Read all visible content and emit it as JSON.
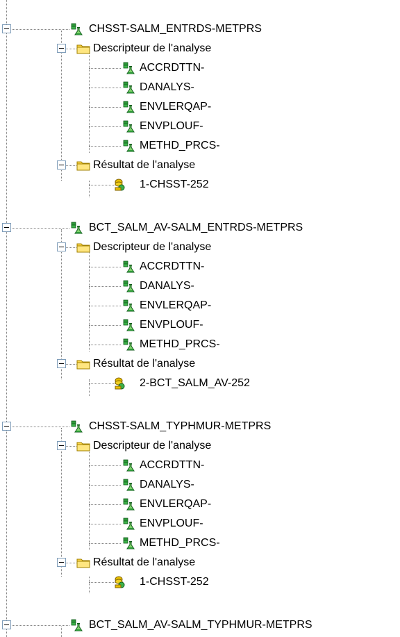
{
  "tree": {
    "nodes": [
      {
        "level": 0,
        "type": "analysis",
        "label": "CHSST-SALM_ENTRDS-METPRS",
        "expanded": true
      },
      {
        "level": 1,
        "type": "folder",
        "label": "Descripteur de l'analyse",
        "expanded": true
      },
      {
        "level": 2,
        "type": "descriptor",
        "label": "ACCRDTTN-"
      },
      {
        "level": 2,
        "type": "descriptor",
        "label": "DANALYS-"
      },
      {
        "level": 2,
        "type": "descriptor",
        "label": "ENVLERQAP-"
      },
      {
        "level": 2,
        "type": "descriptor",
        "label": "ENVPLOUF-"
      },
      {
        "level": 2,
        "type": "descriptor",
        "label": "METHD_PRCS-"
      },
      {
        "level": 1,
        "type": "folder",
        "label": "Résultat de l'analyse",
        "expanded": true
      },
      {
        "level": 2,
        "type": "result",
        "label": "1-CHSST-252"
      },
      {
        "level": 0,
        "type": "analysis",
        "label": "BCT_SALM_AV-SALM_ENTRDS-METPRS",
        "expanded": true
      },
      {
        "level": 1,
        "type": "folder",
        "label": "Descripteur de l'analyse",
        "expanded": true
      },
      {
        "level": 2,
        "type": "descriptor",
        "label": "ACCRDTTN-"
      },
      {
        "level": 2,
        "type": "descriptor",
        "label": "DANALYS-"
      },
      {
        "level": 2,
        "type": "descriptor",
        "label": "ENVLERQAP-"
      },
      {
        "level": 2,
        "type": "descriptor",
        "label": "ENVPLOUF-"
      },
      {
        "level": 2,
        "type": "descriptor",
        "label": "METHD_PRCS-"
      },
      {
        "level": 1,
        "type": "folder",
        "label": "Résultat de l'analyse",
        "expanded": true
      },
      {
        "level": 2,
        "type": "result",
        "label": "2-BCT_SALM_AV-252"
      },
      {
        "level": 0,
        "type": "analysis",
        "label": "CHSST-SALM_TYPHMUR-METPRS",
        "expanded": true
      },
      {
        "level": 1,
        "type": "folder",
        "label": "Descripteur de l'analyse",
        "expanded": true
      },
      {
        "level": 2,
        "type": "descriptor",
        "label": "ACCRDTTN-"
      },
      {
        "level": 2,
        "type": "descriptor",
        "label": "DANALYS-"
      },
      {
        "level": 2,
        "type": "descriptor",
        "label": "ENVLERQAP-"
      },
      {
        "level": 2,
        "type": "descriptor",
        "label": "ENVPLOUF-"
      },
      {
        "level": 2,
        "type": "descriptor",
        "label": "METHD_PRCS-"
      },
      {
        "level": 1,
        "type": "folder",
        "label": "Résultat de l'analyse",
        "expanded": true
      },
      {
        "level": 2,
        "type": "result",
        "label": "1-CHSST-252"
      },
      {
        "level": 0,
        "type": "analysis",
        "label": "BCT_SALM_AV-SALM_TYPHMUR-METPRS",
        "expanded": true
      }
    ]
  },
  "icons": {
    "analysis": "flask-analysis-icon",
    "descriptor": "flask-analysis-icon",
    "folder": "folder-icon",
    "result": "result-coins-icon"
  },
  "colors": {
    "folder_yellow": "#ffd84a",
    "flask_green": "#2e9a3a",
    "result_yellow": "#e8c000",
    "tree_line": "#808080",
    "expander_border": "#7f9db9"
  }
}
